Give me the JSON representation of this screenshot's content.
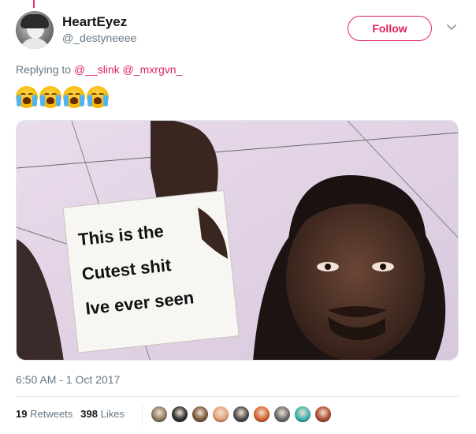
{
  "user": {
    "name": "HeartEyez",
    "handle": "@_destyneeee"
  },
  "follow_button": {
    "label": "Follow"
  },
  "reply": {
    "prefix": "Replying to ",
    "mentions": [
      "@__slink",
      "@_mxrgvn_"
    ]
  },
  "emoji_count": 4,
  "media": {
    "sign_lines": [
      "This is the",
      "Cutest shit",
      "Ive ever seen"
    ]
  },
  "timestamp": "6:50 AM - 1 Oct 2017",
  "stats": {
    "retweets_count": "19",
    "retweets_label": "Retweets",
    "likes_count": "398",
    "likes_label": "Likes"
  },
  "likers": [
    {
      "icon": "liker-avatar-1",
      "color": "#8c7a5f"
    },
    {
      "icon": "liker-avatar-2",
      "color": "#2d2d2d"
    },
    {
      "icon": "liker-avatar-3",
      "color": "#7a5a3c"
    },
    {
      "icon": "liker-avatar-4",
      "color": "#e8a07a"
    },
    {
      "icon": "liker-avatar-5",
      "color": "#4a4a4a"
    },
    {
      "icon": "liker-avatar-6",
      "color": "#d9622b"
    },
    {
      "icon": "liker-avatar-7",
      "color": "#6b6b6b"
    },
    {
      "icon": "liker-avatar-8",
      "color": "#3ab4b0"
    },
    {
      "icon": "liker-avatar-9",
      "color": "#b04a2f"
    }
  ],
  "colors": {
    "accent": "#e0245e",
    "secondary_text": "#657786",
    "primary_text": "#14171a"
  }
}
